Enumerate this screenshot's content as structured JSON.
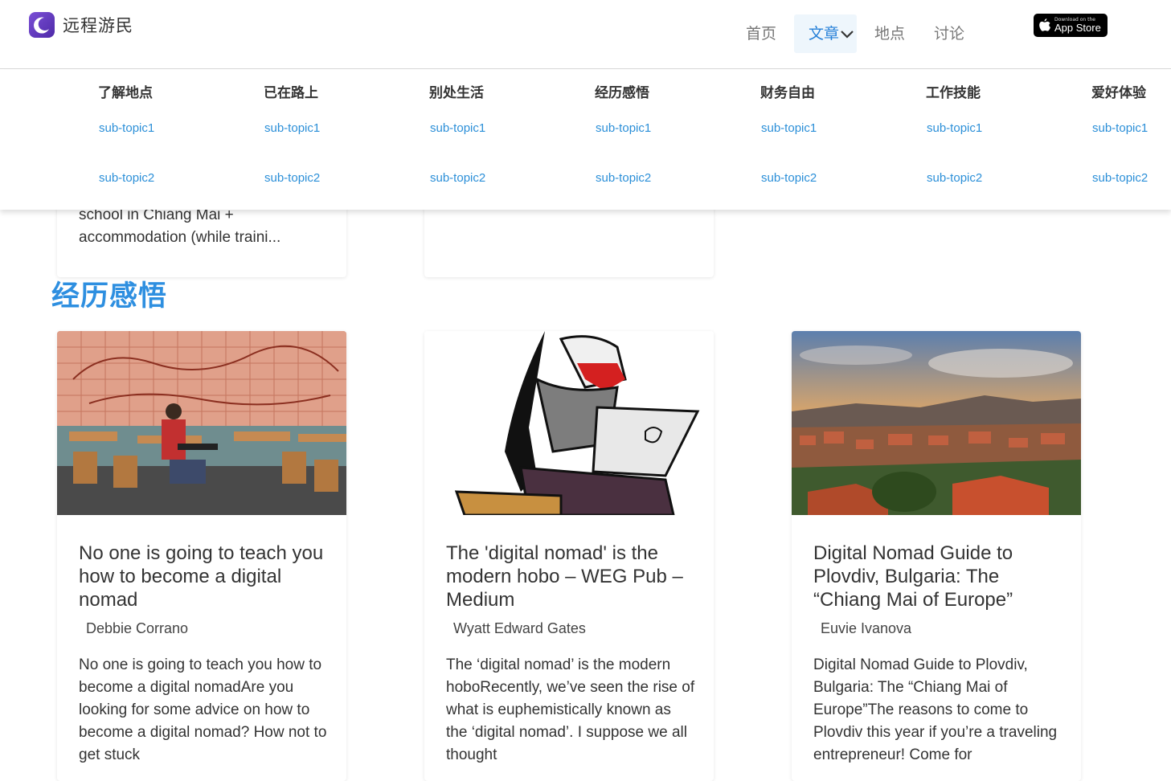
{
  "brand": {
    "name": "远程游民",
    "logo_icon": "crescent-moon-icon",
    "accent": "#5b34c0"
  },
  "nav": {
    "items": [
      {
        "label": "首页",
        "active": false
      },
      {
        "label": "文章",
        "active": true
      },
      {
        "label": "地点",
        "active": false
      },
      {
        "label": "讨论",
        "active": false
      }
    ],
    "active_color": "#2680d8",
    "appstore": {
      "small": "Download on the",
      "big": "App Store"
    }
  },
  "dropdown": {
    "columns": [
      {
        "title": "了解地点",
        "links": [
          "sub-topic1",
          "sub-topic2"
        ]
      },
      {
        "title": "已在路上",
        "links": [
          "sub-topic1",
          "sub-topic2"
        ]
      },
      {
        "title": "别处生活",
        "links": [
          "sub-topic1",
          "sub-topic2"
        ]
      },
      {
        "title": "经历感悟",
        "links": [
          "sub-topic1",
          "sub-topic2"
        ]
      },
      {
        "title": "财务自由",
        "links": [
          "sub-topic1",
          "sub-topic2"
        ]
      },
      {
        "title": "工作技能",
        "links": [
          "sub-topic1",
          "sub-topic2"
        ]
      },
      {
        "title": "爱好体验",
        "links": [
          "sub-topic1",
          "sub-topic2"
        ]
      }
    ],
    "link_color": "#2b8fd8"
  },
  "previous": {
    "excerpt_tail": "school in Chiang Mai + accommodation (while traini..."
  },
  "section": {
    "title": "经历感悟",
    "title_color": "#2e8fe0",
    "cards": [
      {
        "title": "No one is going to teach you how to become a digital nomad",
        "author": "Debbie Corrano",
        "excerpt": "No one is going to teach you how to become a digital nomadAre you looking for some advice on how to become a digital nomad? How not to get stuck",
        "image": "cafe-woman-laptop-photo"
      },
      {
        "title": "The 'digital nomad' is the modern hobo – WEG Pub – Medium",
        "author": "Wyatt Edward Gates",
        "excerpt": "The ‘digital nomad’ is the modern hoboRecently, we’ve seen the rise of what is euphemistically known as the ‘digital nomad’. I suppose we all thought",
        "image": "sketch-hobo-laptop-illustration"
      },
      {
        "title": "Digital Nomad Guide to Plovdiv, Bulgaria: The “Chiang Mai of Europe”",
        "author": "Euvie Ivanova",
        "excerpt": "Digital Nomad Guide to Plovdiv, Bulgaria: The “Chiang Mai of Europe”The reasons to come to Plovdiv this year if you’re a traveling entrepreneur! Come for",
        "image": "plovdiv-sunset-photo"
      }
    ]
  }
}
